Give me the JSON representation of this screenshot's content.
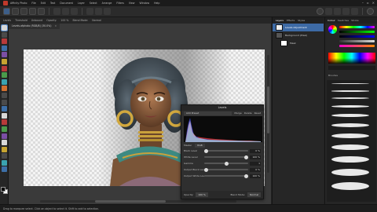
{
  "menubar": {
    "items": [
      "Affinity Photo",
      "File",
      "Edit",
      "Text",
      "Document",
      "Layer",
      "Select",
      "Arrange",
      "Filters",
      "View",
      "Window",
      "Help"
    ]
  },
  "context": {
    "labels": [
      "Levels",
      "Threshold",
      "Unbound",
      "Opacity:",
      "100 %",
      "Blend Mode:",
      "Normal"
    ]
  },
  "document": {
    "tab_title": "Levels.afphoto (RGB/8) (30.0%)",
    "tab_close": "×"
  },
  "levels": {
    "title": "Levels",
    "preset_placeholder": "Add Preset",
    "merge": "Merge",
    "delete": "Delete",
    "reset": "Reset",
    "channel_label": "Master",
    "channel_value": "RGB",
    "rows": [
      {
        "label": "Black Level",
        "value": "0 %",
        "knob": 0.0
      },
      {
        "label": "White Level",
        "value": "100 %",
        "knob": 1.0
      },
      {
        "label": "Gamma",
        "value": "1",
        "knob": 0.5
      },
      {
        "label": "Output Black Level",
        "value": "0 %",
        "knob": 0.0
      },
      {
        "label": "Output White Level",
        "value": "100 %",
        "knob": 1.0
      }
    ],
    "opacity_label": "Opacity:",
    "opacity_value": "100 %",
    "blend_label": "Blend Mode:",
    "blend_value": "Normal"
  },
  "layers": {
    "tabs": [
      "Layers",
      "Effects",
      "Styles"
    ],
    "items": [
      {
        "name": "Levels Adjustment",
        "selected": true
      },
      {
        "name": "Background (Pixel)",
        "selected": false
      },
      {
        "name": "Mask",
        "selected": false
      }
    ]
  },
  "color_panel": {
    "tabs": [
      "Colour",
      "Swatches",
      "Stroke"
    ],
    "brush_tab": "Brushes"
  },
  "status": {
    "text": "Drag to marquee select. Click an object to select it. Shift to add to selection."
  },
  "colors": {
    "accent": "#3d6aa5",
    "app_bg": "#232323"
  }
}
